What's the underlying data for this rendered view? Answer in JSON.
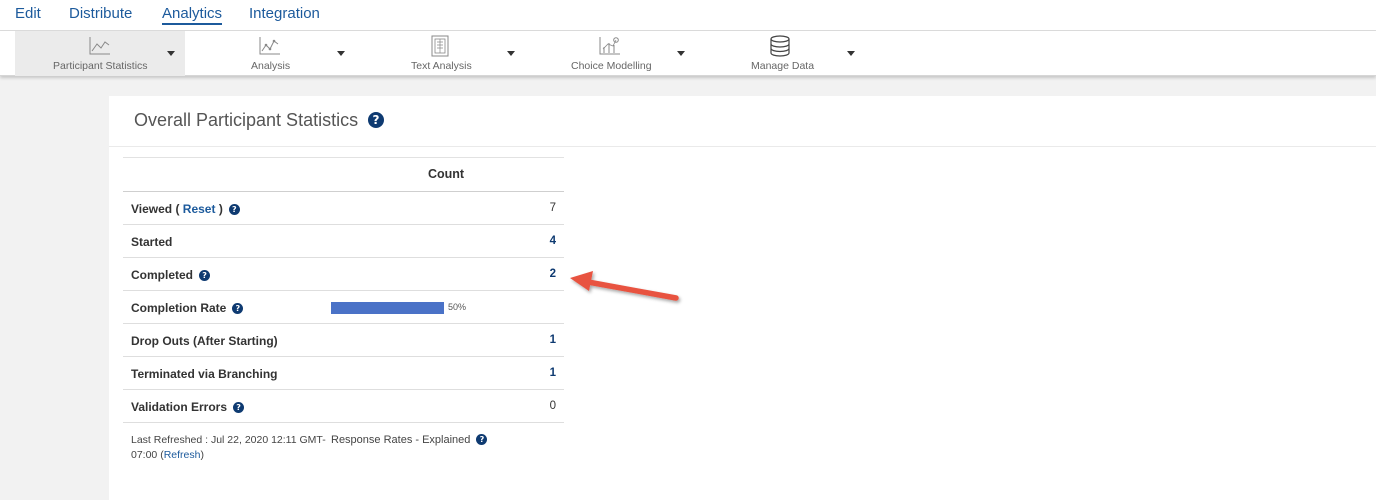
{
  "topnav": {
    "tabs": [
      {
        "label": "Edit"
      },
      {
        "label": "Distribute"
      },
      {
        "label": "Analytics",
        "active": true
      },
      {
        "label": "Integration"
      }
    ]
  },
  "ribbon": {
    "items": [
      {
        "label": "Participant Statistics",
        "icon": "line-chart-icon",
        "active": true
      },
      {
        "label": "Analysis",
        "icon": "scatter-chart-icon"
      },
      {
        "label": "Text Analysis",
        "icon": "document-icon"
      },
      {
        "label": "Choice Modelling",
        "icon": "choice-chart-icon"
      },
      {
        "label": "Manage Data",
        "icon": "database-icon"
      }
    ]
  },
  "panel": {
    "title": "Overall Participant Statistics",
    "help": "?"
  },
  "stats": {
    "header_count": "Count",
    "rows": [
      {
        "label": "Viewed ( ",
        "link": "Reset",
        "label_suffix": " )",
        "value": "7",
        "help": true
      },
      {
        "label": "Started",
        "value": "4"
      },
      {
        "label": "Completed",
        "value": "2",
        "help": true
      },
      {
        "label": "Completion Rate",
        "progress_percent": 50,
        "progress_text": "50%",
        "help": true
      },
      {
        "label": "Drop Outs (After Starting)",
        "value": "1"
      },
      {
        "label": "Terminated via Branching",
        "value": "1"
      },
      {
        "label": "Validation Errors",
        "value": "0",
        "help": true
      }
    ]
  },
  "footer": {
    "last_refreshed": "Last Refreshed : Jul 22, 2020 12:11 GMT-07:00 (",
    "refresh_link": "Refresh",
    "close_paren": ")",
    "response_rates": "Response Rates - Explained"
  },
  "colors": {
    "accent": "#0e3a71",
    "link": "#1c5a9c",
    "bar": "#4a72c7",
    "arrow": "#e8523f"
  }
}
